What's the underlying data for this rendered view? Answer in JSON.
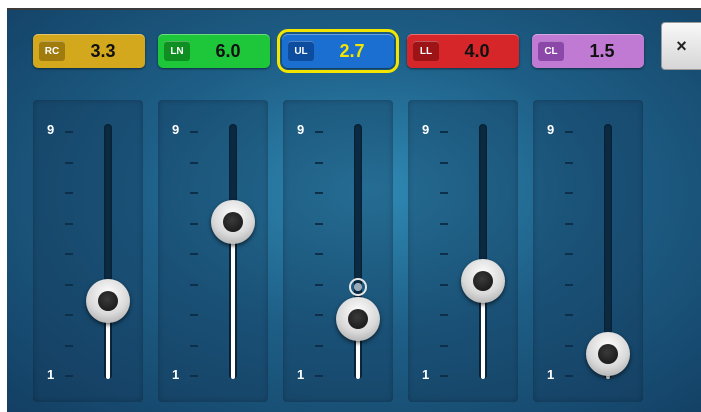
{
  "modes": [
    {
      "id": "rc",
      "badge": "RC",
      "value": "3.3",
      "level": 3.3,
      "color": "#d4a81c",
      "badge_color": "#a07c0e",
      "selected": false
    },
    {
      "id": "ln",
      "badge": "LN",
      "value": "6.0",
      "level": 6.0,
      "color": "#1ec63a",
      "badge_color": "#0f8f22",
      "selected": false
    },
    {
      "id": "ul",
      "badge": "UL",
      "value": "2.7",
      "level": 2.7,
      "color": "#1a6fd0",
      "badge_color": "#0c4da0",
      "selected": true,
      "marker_level": 3.8,
      "value_color": "#f2e600"
    },
    {
      "id": "ll",
      "badge": "LL",
      "value": "4.0",
      "level": 4.0,
      "color": "#d6262a",
      "badge_color": "#9c1416",
      "selected": false
    },
    {
      "id": "cl",
      "badge": "CL",
      "value": "1.5",
      "level": 1.5,
      "color": "#c07ad4",
      "badge_color": "#8c48a8",
      "selected": false
    }
  ],
  "scale": {
    "max": "9",
    "min": "1",
    "max_value": 9,
    "min_value": 1
  },
  "close_label": "×"
}
